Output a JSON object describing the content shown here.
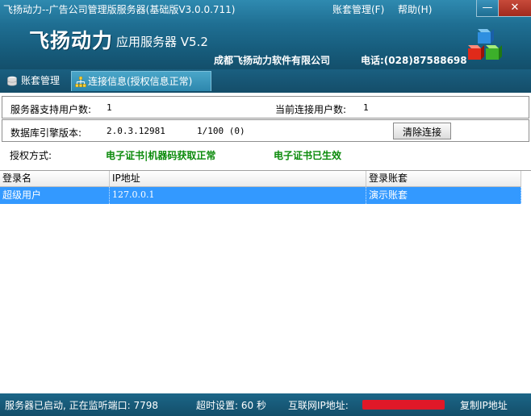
{
  "window": {
    "title": "飞扬动力--广告公司管理版服务器(基础版V3.0.0.711)",
    "menu": {
      "account": "账套管理(F)",
      "help": "帮助(H)"
    },
    "min_symbol": "—",
    "close_symbol": "✕"
  },
  "banner": {
    "app_name": "飞扬动力",
    "app_sub": "应用服务器 V5.2",
    "company": "成都飞扬动力软件有限公司",
    "phone": "电话:(028)87588698",
    "logo_icon": "colored-cubes-icon"
  },
  "tabs": [
    {
      "label": "账套管理",
      "icon": "database-icon"
    },
    {
      "label": "连接信息(授权信息正常)",
      "icon": "network-icon"
    }
  ],
  "info": {
    "supported_users_label": "服务器支持用户数:",
    "supported_users_value": "1",
    "current_users_label": "当前连接用户数:",
    "current_users_value": "1",
    "db_version_label": "数据库引擎版本:",
    "db_version_value": "2.0.3.12981",
    "db_usage_value": "1/100 (0)",
    "clear_button": "清除连接",
    "auth_label": "授权方式:",
    "auth_status": "电子证书|机器码获取正常",
    "cert_status": "电子证书已生效",
    "status_color": "#0a8a0a"
  },
  "table": {
    "headers": [
      "登录名",
      "IP地址",
      "登录账套"
    ],
    "rows": [
      {
        "login": "超级用户",
        "ip": "127.0.0.1",
        "account": "演示账套",
        "selected": true
      }
    ],
    "selection_color": "#3399ff"
  },
  "status": {
    "listening": "服务器已启动, 正在监听端口: 7798",
    "timeout": "超时设置: 60 秒",
    "ip_label": "互联网IP地址:",
    "copy_ip": "复制IP地址"
  }
}
